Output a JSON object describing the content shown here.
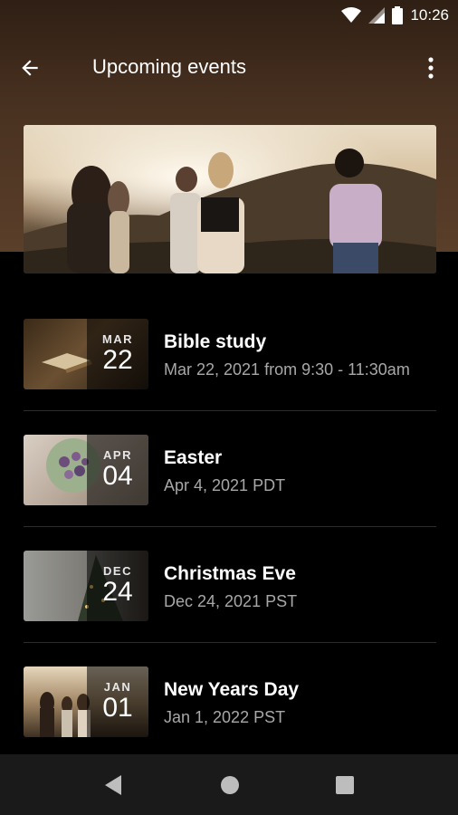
{
  "status_bar": {
    "time": "10:26",
    "icons": [
      "wifi-icon",
      "signal-icon",
      "battery-icon"
    ]
  },
  "app_bar": {
    "title": "Upcoming events",
    "back_icon": "arrow-back-icon",
    "menu_icon": "more-vert-icon"
  },
  "events": [
    {
      "title": "Bible study",
      "subtitle": "Mar 22, 2021 from 9:30 - 11:30am",
      "month": "MAR",
      "day": "22"
    },
    {
      "title": "Easter",
      "subtitle": "Apr 4, 2021 PDT",
      "month": "APR",
      "day": "04"
    },
    {
      "title": "Christmas Eve",
      "subtitle": "Dec 24, 2021 PST",
      "month": "DEC",
      "day": "24"
    },
    {
      "title": "New Years Day",
      "subtitle": "Jan 1, 2022 PST",
      "month": "JAN",
      "day": "01"
    }
  ],
  "nav_bar": {
    "icons": [
      "back-triangle-icon",
      "home-circle-icon",
      "recents-square-icon"
    ]
  },
  "colors": {
    "header_brown": "#4a3221",
    "background": "#000000",
    "subtitle_gray": "#a8a8a8",
    "nav_bar": "#1a1a1a"
  }
}
